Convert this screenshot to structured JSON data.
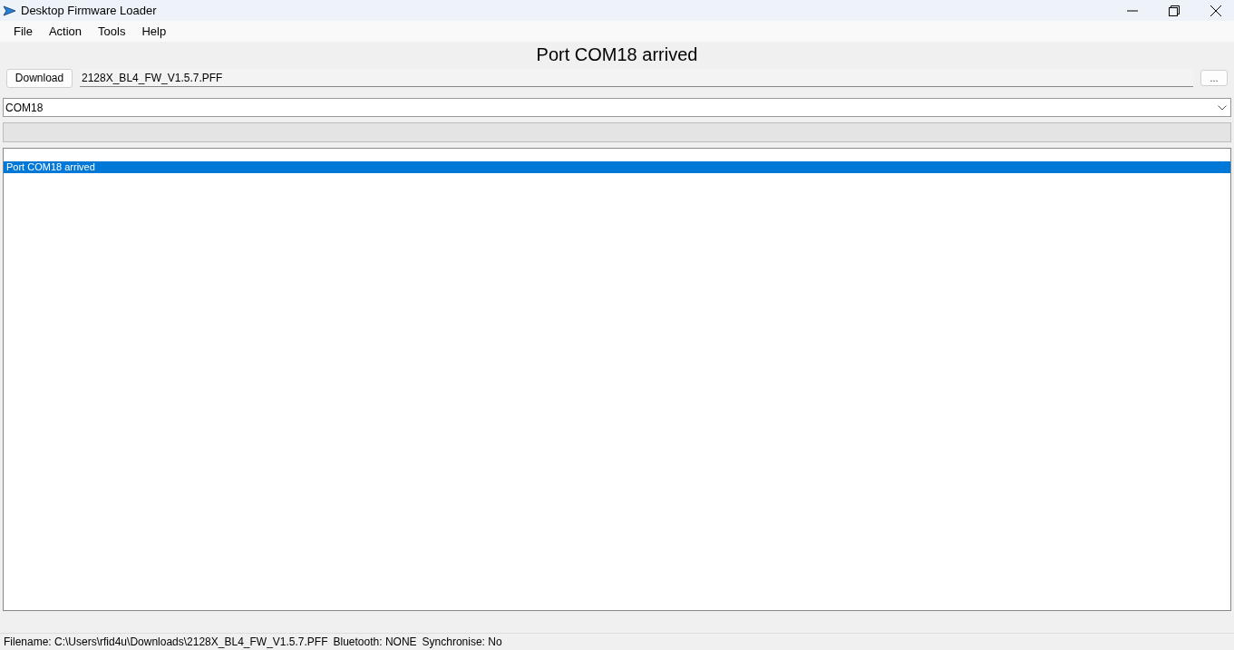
{
  "window": {
    "title": "Desktop Firmware Loader"
  },
  "menu": [
    "File",
    "Action",
    "Tools",
    "Help"
  ],
  "heading": "Port COM18 arrived",
  "download_button": "Download",
  "file_field": {
    "value": "2128X_BL4_FW_V1.5.7.PFF"
  },
  "browse_button": "...",
  "port_combo": {
    "value": "COM18"
  },
  "progress": {
    "level": 0
  },
  "log": [
    {
      "text": "Port COM18 arrived",
      "selected": true
    }
  ],
  "status_bar": [
    "Filename: C:\\Users\\rfid4u\\Downloads\\2128X_BL4_FW_V1.5.7.PFF",
    "Bluetooth: NONE",
    "Synchronise: No"
  ]
}
